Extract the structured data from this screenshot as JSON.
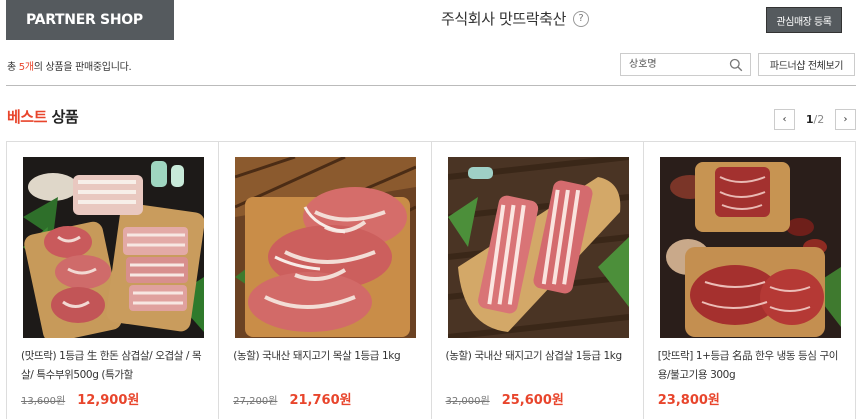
{
  "header": {
    "badge": "PARTNER SHOP",
    "shop_name": "주식회사 맛뜨락축산",
    "help_icon": "?",
    "favorite_button": "관심매장 등록"
  },
  "info": {
    "count_prefix": "총 ",
    "count_value": "5개",
    "count_suffix": "의 상품을 판매중입니다.",
    "search_placeholder": "상호명",
    "search_icon": "search-icon",
    "view_all_button": "파드너샵 전체보기"
  },
  "section": {
    "title_accent": "베스트",
    "title_rest": " 상품",
    "pager_prev": "‹",
    "pager_current": "1",
    "pager_sep": "/",
    "pager_total": "2",
    "pager_next": "›"
  },
  "products": [
    {
      "name": "(맛뜨락) 1등급 生 한돈 삼겹살/ 오겹살 / 목살/ 특수부위500g (특가할",
      "old_price": "13,600원",
      "new_price": "12,900원"
    },
    {
      "name": "(농할) 국내산 돼지고기 목살 1등급 1kg",
      "old_price": "27,200원",
      "new_price": "21,760원"
    },
    {
      "name": "(농할) 국내산 돼지고기 삼겹살 1등급 1kg",
      "old_price": "32,000원",
      "new_price": "25,600원"
    },
    {
      "name": "[맛뜨락] 1+등급 名品 한우 냉동 등심 구이용/불고기용 300g",
      "old_price": "",
      "new_price": "23,800원"
    }
  ],
  "colors": {
    "accent": "#e8452c",
    "badge_bg": "#555a5e"
  }
}
